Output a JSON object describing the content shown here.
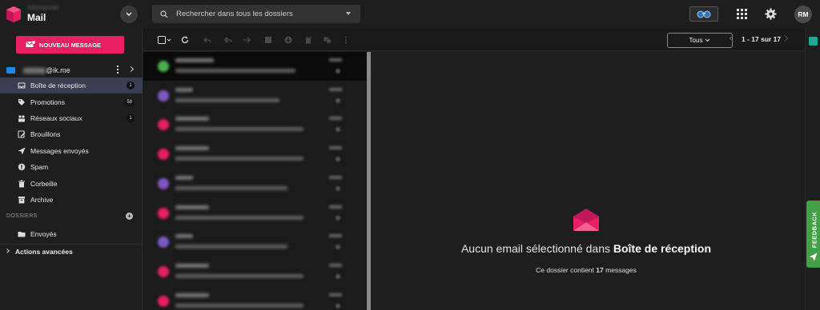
{
  "app": {
    "title": "Mail",
    "subtitle": "Infomaniak"
  },
  "search": {
    "placeholder": "Rechercher dans tous les dossiers"
  },
  "user": {
    "initials": "RM"
  },
  "compose": {
    "label": "NOUVEAU MESSAGE"
  },
  "account": {
    "label": "@ik.me"
  },
  "sidebar": {
    "items": [
      {
        "label": "Boîte de réception",
        "badge": "1",
        "icon": "inbox-icon",
        "active": true
      },
      {
        "label": "Promotions",
        "badge": "58",
        "icon": "tag-icon"
      },
      {
        "label": "Réseaux sociaux",
        "badge": "1",
        "icon": "people-icon"
      },
      {
        "label": "Brouillons",
        "badge": "",
        "icon": "draft-icon"
      },
      {
        "label": "Messages envoyés",
        "badge": "",
        "icon": "send-icon"
      },
      {
        "label": "Spam",
        "badge": "",
        "icon": "spam-icon"
      },
      {
        "label": "Corbeille",
        "badge": "",
        "icon": "trash-icon"
      },
      {
        "label": "Archive",
        "badge": "",
        "icon": "archive-icon"
      }
    ],
    "folders_heading": "DOSSIERS",
    "folders": [
      {
        "label": "Envoyés",
        "icon": "folder-icon"
      }
    ],
    "advanced": "Actions avancées"
  },
  "toolbar": {
    "filter": "Tous",
    "pager": "1 - 17 sur 17"
  },
  "messages": [
    {
      "color": "#4caf50"
    },
    {
      "color": "#7e57c2"
    },
    {
      "color": "#e91e63"
    },
    {
      "color": "#e91e63"
    },
    {
      "color": "#7e57c2"
    },
    {
      "color": "#e91e63"
    },
    {
      "color": "#7e57c2"
    },
    {
      "color": "#e91e63"
    },
    {
      "color": "#e91e63"
    }
  ],
  "pane": {
    "title_prefix": "Aucun email sélectionné dans",
    "title_folder": "Boîte de réception",
    "sub_prefix": "Ce dossier contient",
    "sub_count": "17",
    "sub_suffix": "messages"
  },
  "feedback": {
    "label": "FEEDBACK"
  },
  "colors": {
    "accent": "#e91e63",
    "feedback": "#43a047",
    "active_row": "#3b3d52"
  }
}
